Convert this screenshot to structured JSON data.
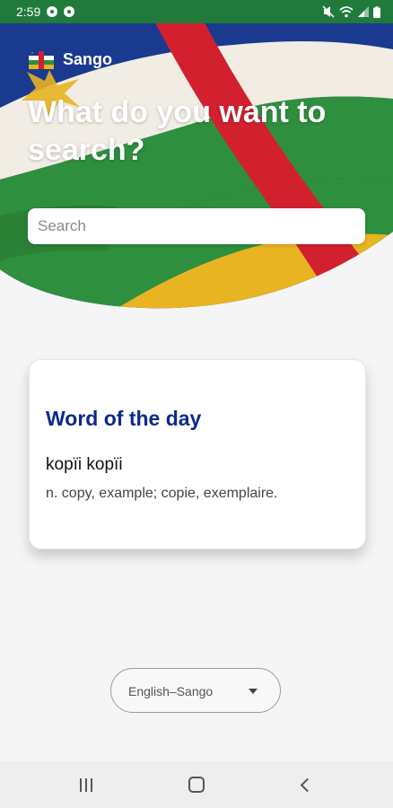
{
  "status_bar": {
    "time": "2:59",
    "left_icons": [
      "circle-notification-icon",
      "chat-notification-icon"
    ],
    "right_icons": [
      "mute-icon",
      "wifi-icon",
      "signal-icon",
      "battery-icon"
    ]
  },
  "header": {
    "app_name": "Sango",
    "headline": "What do you want to search?",
    "logo_icon": "central-african-flag-icon",
    "colors": {
      "blue": "#1a3a8f",
      "white": "#f1ece4",
      "green": "#2e8f3e",
      "yellow": "#e8b422",
      "red": "#d2202f"
    }
  },
  "search": {
    "placeholder": "Search",
    "value": ""
  },
  "word_of_the_day": {
    "title": "Word of the day",
    "word": "kopïi kopïi",
    "definition": "n. copy, example; copie, exemplaire."
  },
  "language_selector": {
    "selected": "English–Sango",
    "icon": "chevron-down-icon"
  },
  "nav_bar": {
    "buttons": [
      "recent-apps-icon",
      "home-icon",
      "back-icon"
    ]
  }
}
